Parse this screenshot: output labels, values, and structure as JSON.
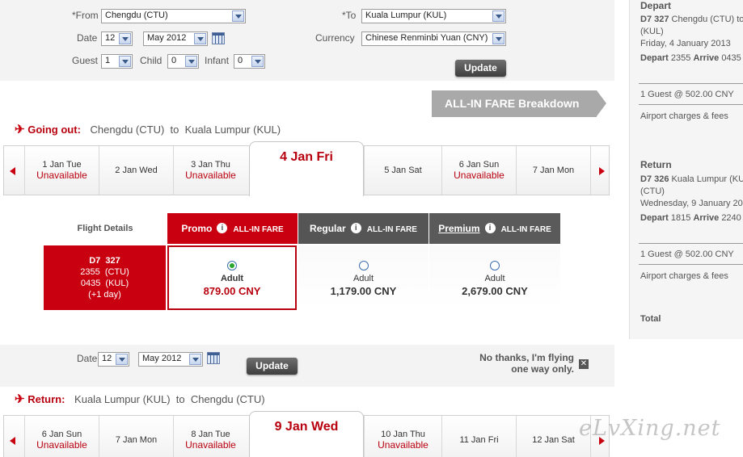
{
  "search": {
    "from_label": "*From",
    "from_value": "Chengdu (CTU)",
    "to_label": "*To",
    "to_value": "Kuala Lumpur (KUL)",
    "date_label": "Date",
    "day_value": "12",
    "month_value": "May 2012",
    "currency_label": "Currency",
    "currency_value": "Chinese Renminbi Yuan (CNY)",
    "guest_label": "Guest",
    "guest_value": "1",
    "child_label": "Child",
    "child_value": "0",
    "infant_label": "Infant",
    "infant_value": "0",
    "update_label": "Update"
  },
  "breakdown_label": "ALL-IN FARE Breakdown",
  "going": {
    "title_prefix": "Going out:",
    "route": "Chengdu (CTU)  to  Kuala Lumpur (KUL)",
    "days": [
      {
        "date": "1 Jan Tue",
        "status": "Unavailable"
      },
      {
        "date": "2 Jan Wed",
        "status": ""
      },
      {
        "date": "3 Jan Thu",
        "status": "Unavailable"
      },
      {
        "date": "4 Jan Fri",
        "status": "",
        "selected": true
      },
      {
        "date": "5 Jan Sat",
        "status": ""
      },
      {
        "date": "6 Jan Sun",
        "status": "Unavailable"
      },
      {
        "date": "7 Jan Mon",
        "status": ""
      }
    ]
  },
  "fares": {
    "details_header": "Flight Details",
    "columns": [
      {
        "name": "Promo",
        "tag": "ALL-IN FARE",
        "pax": "Adult",
        "price": "879.00 CNY",
        "selected": true
      },
      {
        "name": "Regular",
        "tag": "ALL-IN FARE",
        "pax": "Adult",
        "price": "1,179.00 CNY",
        "selected": false
      },
      {
        "name": "Premium",
        "tag": "ALL-IN FARE",
        "pax": "Adult",
        "price": "2,679.00 CNY",
        "selected": false
      }
    ],
    "flight": {
      "number": "D7  327",
      "depart": "2355  (CTU)",
      "arrive": "0435  (KUL)",
      "note": "(+1 day)"
    },
    "info_icon": "info-icon"
  },
  "return_search": {
    "date_label": "Date",
    "day_value": "12",
    "month_value": "May 2012",
    "update_label": "Update",
    "one_way_line1": "No thanks, I'm flying",
    "one_way_line2": "one way only."
  },
  "returning": {
    "title_prefix": "Return:",
    "route": "Kuala Lumpur (KUL)  to  Chengdu (CTU)",
    "days": [
      {
        "date": "6 Jan Sun",
        "status": "Unavailable"
      },
      {
        "date": "7 Jan Mon",
        "status": ""
      },
      {
        "date": "8 Jan Tue",
        "status": "Unavailable"
      },
      {
        "date": "9 Jan Wed",
        "status": "",
        "selected": true
      },
      {
        "date": "10 Jan Thu",
        "status": "Unavailable"
      },
      {
        "date": "11 Jan Fri",
        "status": ""
      },
      {
        "date": "12 Jan Sat",
        "status": ""
      }
    ]
  },
  "summary": {
    "depart_head": "Depart",
    "depart_flight_no": "D7 327",
    "depart_flight_route": " Chengdu (CTU) to",
    "depart_flight_route2": "(KUL)",
    "depart_date": "Friday, 4 January 2013",
    "depart_depart_label": "Depart",
    "depart_depart_time": "2355",
    "depart_arrive_label": "Arrive",
    "depart_arrive_time": "0435",
    "depart_guest": "1 Guest @ 502.00 CNY",
    "depart_charges": "Airport charges & fees",
    "return_head": "Return",
    "return_flight_no": "D7 326",
    "return_flight_route": " Kuala Lumpur (KUL",
    "return_flight_route2": "(CTU)",
    "return_date": "Wednesday, 9 January 20",
    "return_depart_label": "Depart",
    "return_depart_time": "1815",
    "return_arrive_label": "Arrive",
    "return_arrive_time": "2240",
    "return_guest": "1 Guest @ 502.00 CNY",
    "return_charges": "Airport charges & fees",
    "total_label": "Total"
  },
  "watermark": "eLvXing.net",
  "colors": {
    "brand_red": "#c8000f",
    "regular_grey": "#555555",
    "premium_grey": "#5a5a5a",
    "breakdown_grey": "#a9a9a9"
  }
}
